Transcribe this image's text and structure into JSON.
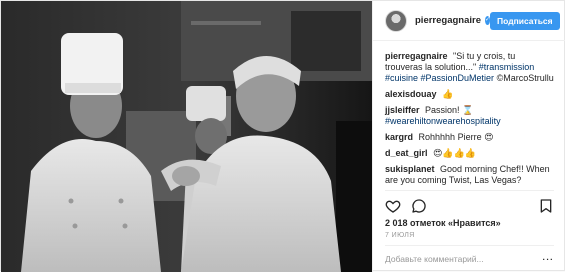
{
  "post": {
    "username": "pierregagnaire",
    "verified_glyph": "✓",
    "follow_label": "Подписаться",
    "caption": {
      "user": "pierregagnaire",
      "text": "\"Si tu y crois, tu trouveras la solution...\"",
      "hashtags": "#transmission #cuisine #PassionDuMetier",
      "credit": "©MarcoStrullu"
    },
    "comments": [
      {
        "user": "alexisdouay",
        "text": "👍"
      },
      {
        "user": "jjsleiffer",
        "text": "Passion! ⌛",
        "hashtag": "#wearehiltonwearehospitality"
      },
      {
        "user": "kargrd",
        "text": "Rohhhhh Pierre 😍"
      },
      {
        "user": "d_eat_girl",
        "text": "😍👍👍👍"
      },
      {
        "user": "sukisplanet",
        "text": "Good morning Chef!! When are you coming Twist, Las Vegas?"
      }
    ],
    "likes": "2 018 отметок «Нравится»",
    "date": "7 ИЮЛЯ",
    "add_comment_placeholder": "Добавьте комментарий...",
    "more_glyph": "···"
  },
  "colors": {
    "accent": "#3897f0",
    "link": "#003569",
    "muted": "#999999"
  },
  "icons": [
    "heart-icon",
    "comment-icon",
    "bookmark-icon",
    "more-options-icon"
  ]
}
